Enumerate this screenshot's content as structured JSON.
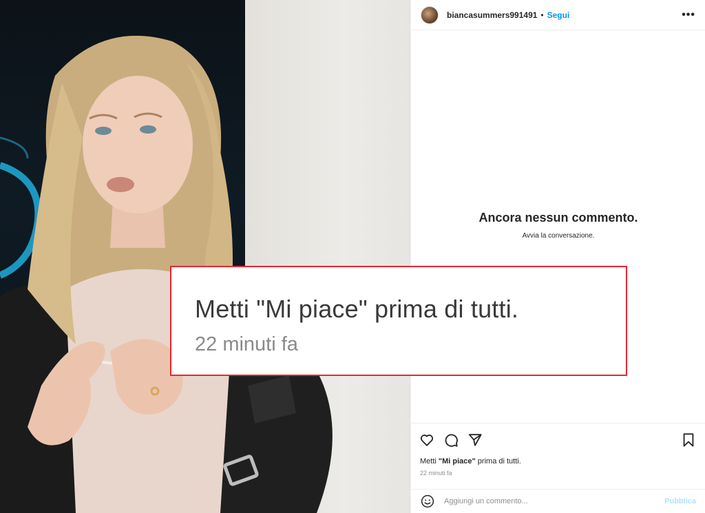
{
  "post": {
    "username": "biancasummers991491",
    "separator": "•",
    "follow_label": "Segui",
    "more_label": "•••"
  },
  "comments": {
    "empty_title": "Ancora nessun commento.",
    "empty_subtitle": "Avvia la conversazione."
  },
  "likes": {
    "prefix": "Metti ",
    "bold": "\"Mi piace\"",
    "suffix": " prima di tutti.",
    "full": "Metti \"Mi piace\" prima di tutti.",
    "time": "22 minuti fa"
  },
  "comment_box": {
    "placeholder": "Aggiungi un commento...",
    "publish_label": "Pubblica"
  },
  "callout": {
    "text": "Metti \"Mi piace\" prima di tutti.",
    "time": "22 minuti fa",
    "border_color": "#e8262f"
  },
  "icons": {
    "like": "heart-icon",
    "comment": "comment-icon",
    "share": "send-icon",
    "save": "bookmark-icon",
    "emoji": "emoji-icon",
    "more": "more-horizontal-icon"
  },
  "colors": {
    "accent": "#0095f6",
    "publish_disabled": "#b2dffc",
    "callout_border": "#e8262f"
  }
}
